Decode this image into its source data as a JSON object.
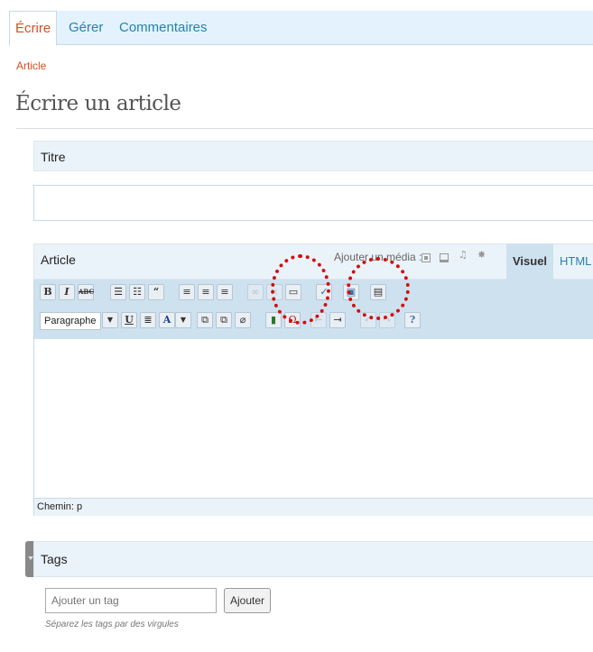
{
  "tabs": [
    {
      "label": "Écrire"
    },
    {
      "label": "Gérer"
    },
    {
      "label": "Commentaires"
    }
  ],
  "subnav": {
    "label": "Article"
  },
  "page_title": "Écrire un article",
  "titre_box": {
    "label": "Titre",
    "value": ""
  },
  "article_box": {
    "label": "Article",
    "media_label": "Ajouter un média :",
    "media_icons": [
      "image-icon",
      "video-icon",
      "audio-icon",
      "media-icon"
    ],
    "tab_visuel": "Visuel",
    "tab_html": "HTML",
    "format_select": "Paragraphe",
    "status_path": "Chemin: p"
  },
  "tags_box": {
    "label": "Tags",
    "input_placeholder": "Ajouter un tag",
    "add_button": "Ajouter",
    "hint": "Séparez les tags par des virgules"
  },
  "colors": {
    "accent": "#d54e21",
    "link": "#2583ad",
    "highlight": "#d01010"
  }
}
